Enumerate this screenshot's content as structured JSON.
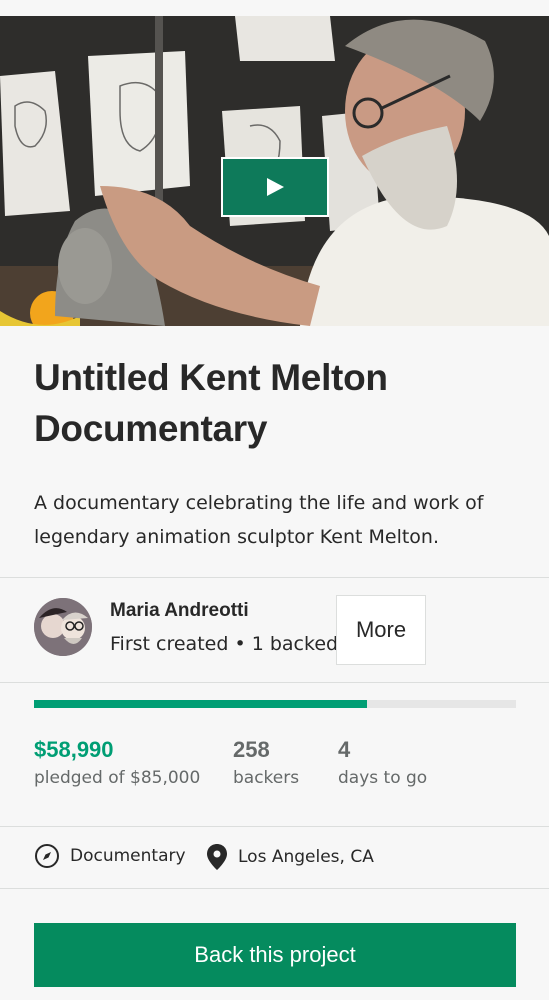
{
  "video": {
    "play_icon": "play-icon",
    "accent": "#0e7a5a"
  },
  "project": {
    "title": "Untitled Kent Melton Documentary",
    "blurb": "A documentary celebrating the life and work of legendary animation sculptor Kent Melton."
  },
  "creator": {
    "name": "Maria Andreotti",
    "created": "First created",
    "separator": "•",
    "backed": "1 backed",
    "more_label": "More"
  },
  "funding": {
    "progress_fraction": 0.69,
    "pledged_value": "$58,990",
    "pledged_label": "pledged of $85,000",
    "backers_value": "258",
    "backers_label": "backers",
    "days_value": "4",
    "days_label": "days to go"
  },
  "tags": {
    "category_icon": "compass-icon",
    "category": "Documentary",
    "location_icon": "map-pin-icon",
    "location": "Los Angeles, CA"
  },
  "cta": {
    "back_label": "Back this project"
  },
  "colors": {
    "brand_green": "#009e74",
    "button_green": "#058b5e",
    "text": "#282828",
    "muted": "#656969"
  }
}
